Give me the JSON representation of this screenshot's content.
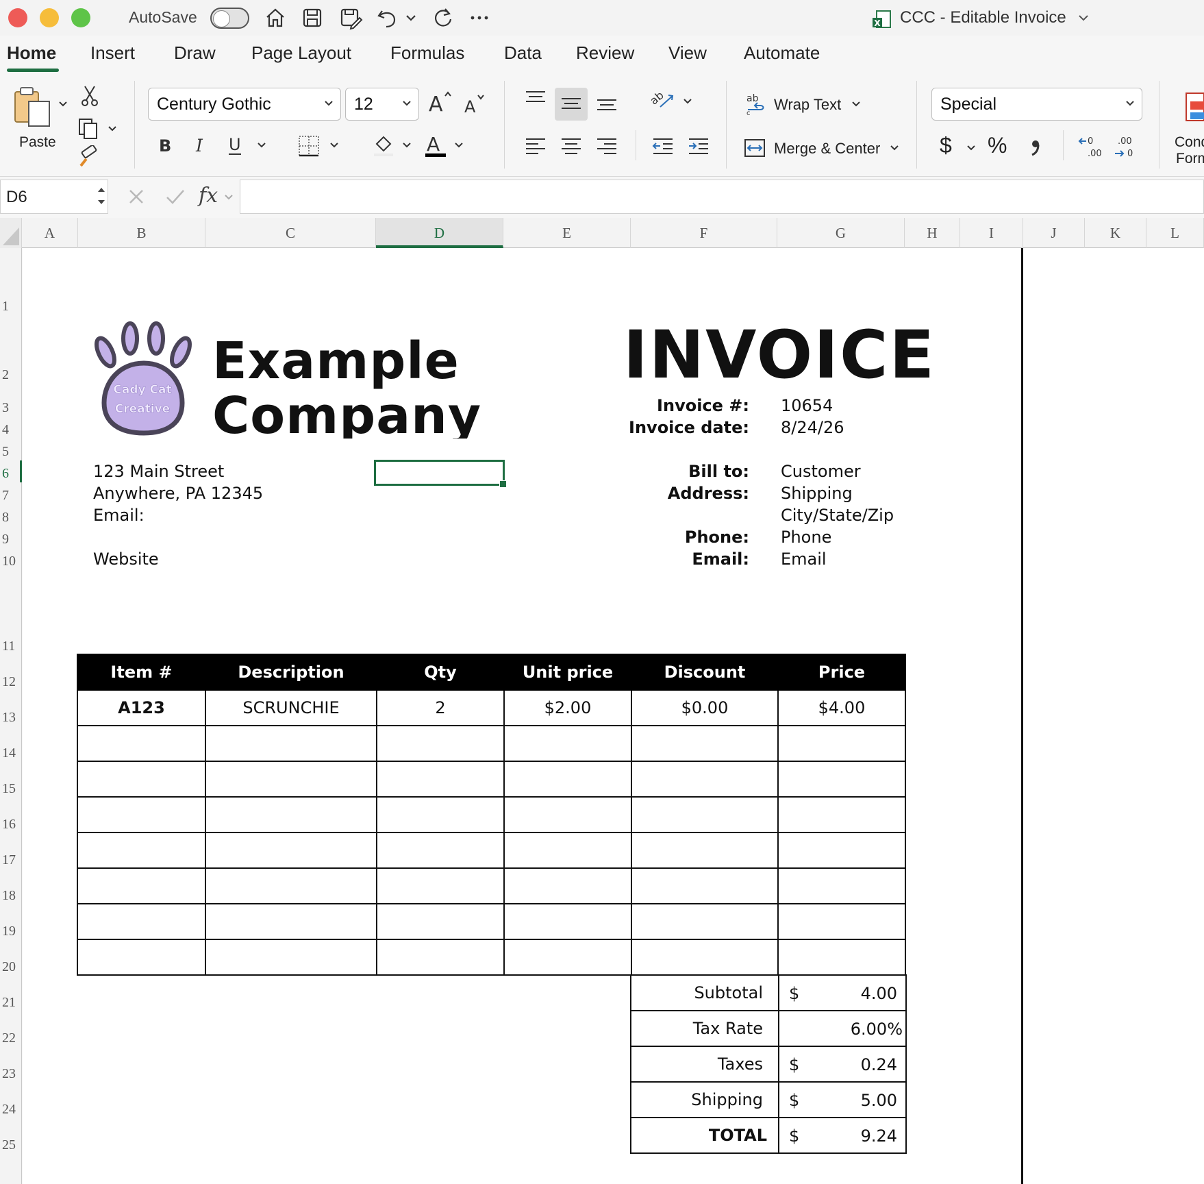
{
  "window": {
    "autosave_label": "AutoSave",
    "document_title": "CCC - Editable Invoice"
  },
  "tabs": [
    "Home",
    "Insert",
    "Draw",
    "Page Layout",
    "Formulas",
    "Data",
    "Review",
    "View",
    "Automate"
  ],
  "ribbon": {
    "paste_label": "Paste",
    "font_name": "Century Gothic",
    "font_size": "12",
    "wrap_text_label": "Wrap Text",
    "merge_center_label": "Merge & Center",
    "number_format": "Special",
    "currency_symbol": "$",
    "percent_symbol": "%",
    "conditional_formatting_line1": "Cond",
    "conditional_formatting_line2": "Form"
  },
  "formula_bar": {
    "name_box": "D6",
    "fx_label": "fx",
    "formula": ""
  },
  "grid": {
    "columns": [
      "A",
      "B",
      "C",
      "D",
      "E",
      "F",
      "G",
      "H",
      "I",
      "J",
      "K",
      "L"
    ],
    "rows": [
      "1",
      "2",
      "3",
      "4",
      "5",
      "6",
      "7",
      "8",
      "9",
      "10",
      "11",
      "12",
      "13",
      "14",
      "15",
      "16",
      "17",
      "18",
      "19",
      "20",
      "21",
      "22",
      "23",
      "24",
      "25"
    ],
    "selected_cell": "D6"
  },
  "invoice": {
    "logo_text_line1": "Cady Cat",
    "logo_text_line2": "Creative",
    "company_line1": "Example",
    "company_line2": "Company",
    "title": "INVOICE",
    "invoice_number_label": "Invoice #:",
    "invoice_number": "10654",
    "invoice_date_label": "Invoice date:",
    "invoice_date": "8/24/26",
    "street": "123 Main Street",
    "city_line": "Anywhere, PA 12345",
    "email_label": "Email:",
    "website": "Website",
    "bill_to_label": "Bill to:",
    "bill_to_value": "Customer",
    "address_label": "Address:",
    "address_line1": "Shipping",
    "address_line2": "City/State/Zip",
    "phone_label": "Phone:",
    "phone_value": "Phone",
    "customer_email_label": "Email:",
    "customer_email_value": "Email",
    "table_headers": [
      "Item #",
      "Description",
      "Qty",
      "Unit price",
      "Discount",
      "Price"
    ],
    "table_rows": [
      [
        "A123",
        "SCRUNCHIE",
        "2",
        "$2.00",
        "$0.00",
        "$4.00"
      ],
      [
        "",
        "",
        "",
        "",
        "",
        ""
      ],
      [
        "",
        "",
        "",
        "",
        "",
        ""
      ],
      [
        "",
        "",
        "",
        "",
        "",
        ""
      ],
      [
        "",
        "",
        "",
        "",
        "",
        ""
      ],
      [
        "",
        "",
        "",
        "",
        "",
        ""
      ],
      [
        "",
        "",
        "",
        "",
        "",
        ""
      ],
      [
        "",
        "",
        "",
        "",
        "",
        ""
      ]
    ],
    "totals": [
      {
        "label": "Subtotal",
        "currency": "$",
        "value": "4.00"
      },
      {
        "label": "Tax Rate",
        "currency": "",
        "value": "6.00%"
      },
      {
        "label": "Taxes",
        "currency": "$",
        "value": "0.24"
      },
      {
        "label": "Shipping",
        "currency": "$",
        "value": "5.00"
      },
      {
        "label": "TOTAL",
        "currency": "$",
        "value": "9.24"
      }
    ]
  },
  "colors": {
    "excel_green": "#1e6e42",
    "logo_purple": "#c3b1e8",
    "logo_outline": "#4a4458",
    "close": "#ee5b57",
    "minimize": "#f6bd3b",
    "maximize": "#5ec448"
  }
}
